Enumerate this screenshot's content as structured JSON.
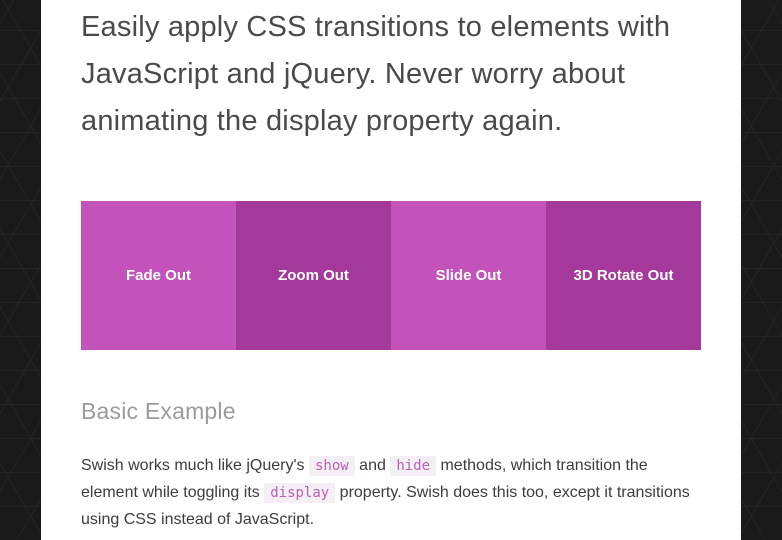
{
  "intro": "Easily apply CSS transitions to elements with JavaScript and jQuery. Never worry about animating the display property again.",
  "demo_buttons": [
    {
      "label": "Fade Out"
    },
    {
      "label": "Zoom Out"
    },
    {
      "label": "Slide Out"
    },
    {
      "label": "3D Rotate Out"
    }
  ],
  "section_title": "Basic Example",
  "body": {
    "p1a": "Swish works much like jQuery's ",
    "code_show": "show",
    "p1b": " and ",
    "code_hide": "hide",
    "p1c": " methods, which transition the element while toggling its ",
    "code_display": "display",
    "p1d": " property. Swish does this too, except it transitions using CSS instead of JavaScript."
  }
}
